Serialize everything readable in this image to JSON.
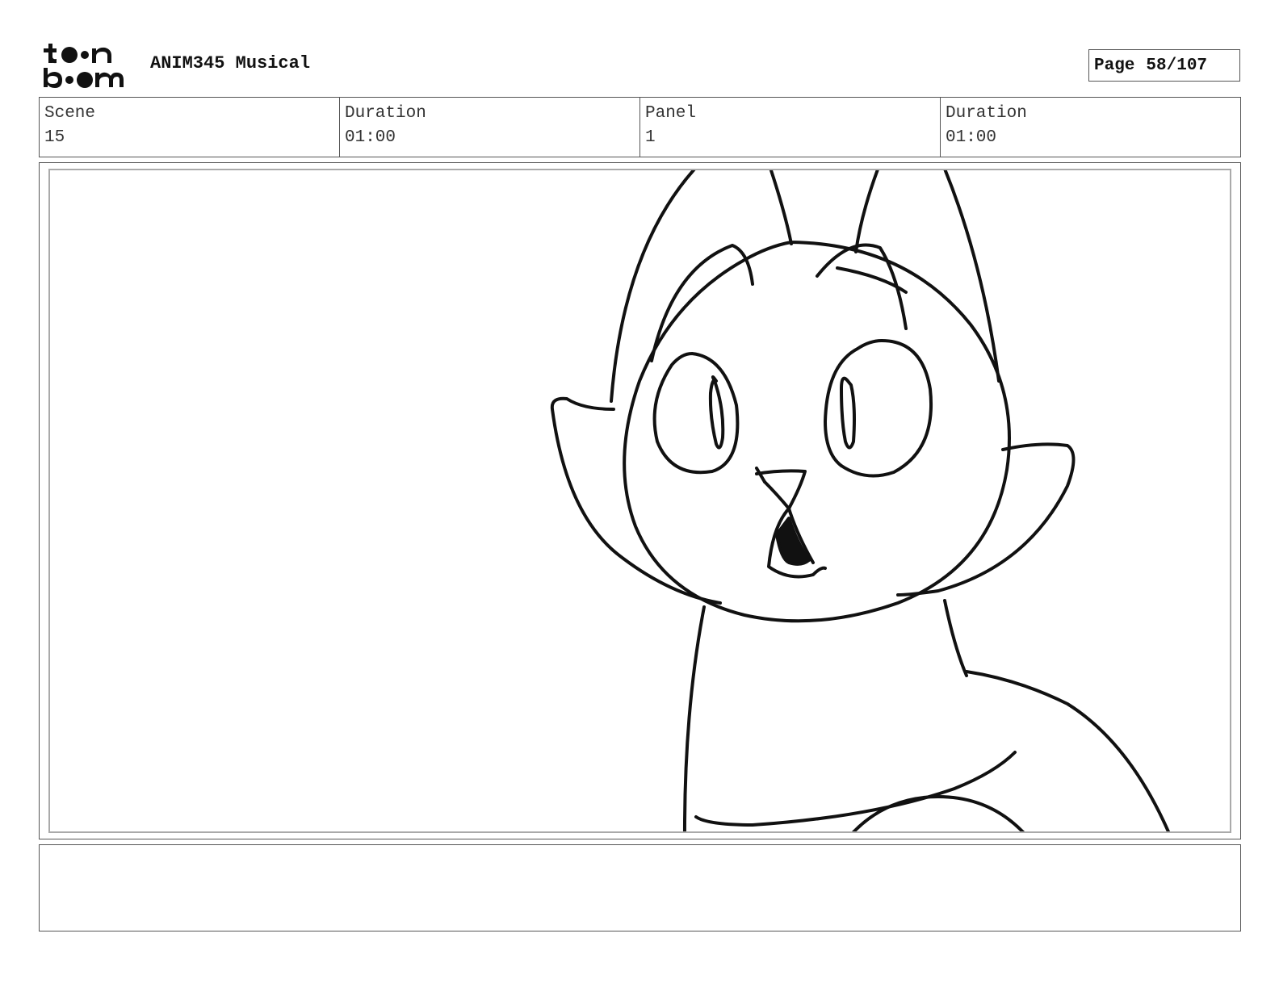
{
  "header": {
    "logo_line1": "toon",
    "logo_line2": "boom",
    "project_title": "ANIM345 Musical",
    "page_label": "Page",
    "page_number": "58/107"
  },
  "info": {
    "scene_label": "Scene",
    "scene_value": "15",
    "scene_duration_label": "Duration",
    "scene_duration_value": "01:00",
    "panel_label": "Panel",
    "panel_value": "1",
    "panel_duration_label": "Duration",
    "panel_duration_value": "01:00"
  },
  "panel": {
    "drawing": "cat-sketch-icon"
  },
  "notes": {
    "text": ""
  }
}
